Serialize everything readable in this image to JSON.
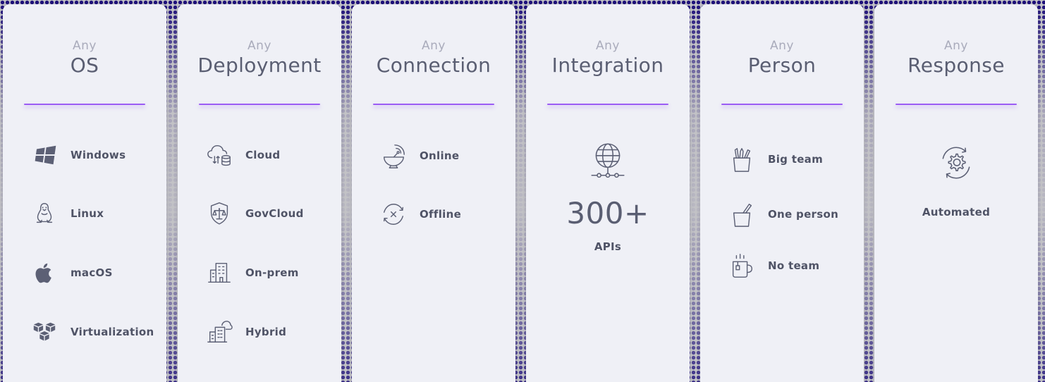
{
  "cards": [
    {
      "prefix": "Any",
      "title": "OS",
      "items": [
        {
          "icon": "windows-icon",
          "label": "Windows"
        },
        {
          "icon": "linux-icon",
          "label": "Linux"
        },
        {
          "icon": "apple-icon",
          "label": "macOS"
        },
        {
          "icon": "virtualization-icon",
          "label": "Virtualization"
        }
      ]
    },
    {
      "prefix": "Any",
      "title": "Deployment",
      "items": [
        {
          "icon": "cloud-database-icon",
          "label": "Cloud"
        },
        {
          "icon": "govcloud-shield-icon",
          "label": "GovCloud"
        },
        {
          "icon": "building-icon",
          "label": "On-prem"
        },
        {
          "icon": "hybrid-building-cloud-icon",
          "label": "Hybrid"
        }
      ]
    },
    {
      "prefix": "Any",
      "title": "Connection",
      "items": [
        {
          "icon": "satellite-dish-icon",
          "label": "Online"
        },
        {
          "icon": "offline-sync-icon",
          "label": "Offline"
        }
      ]
    },
    {
      "prefix": "Any",
      "title": "Integration",
      "icon": "globe-network-icon",
      "number": "300+",
      "label": "APIs"
    },
    {
      "prefix": "Any",
      "title": "Person",
      "items": [
        {
          "icon": "pencil-cup-icon",
          "label": "Big team"
        },
        {
          "icon": "single-pencil-cup-icon",
          "label": "One person"
        },
        {
          "icon": "coffee-mug-icon",
          "label": "No team"
        }
      ]
    },
    {
      "prefix": "Any",
      "title": "Response",
      "icon": "automation-gear-icon",
      "label": "Automated"
    }
  ],
  "colors": {
    "accent": "#9b5cf4",
    "card_bg": "#eff0f6",
    "text": "#4f5366",
    "muted": "#a9abbb",
    "dots": "#1c0d7a"
  }
}
